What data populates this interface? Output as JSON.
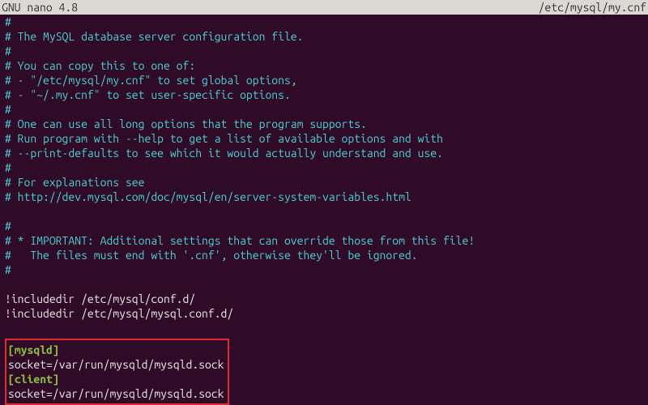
{
  "titlebar": {
    "app": "  GNU nano 4.8",
    "file": "/etc/mysql/my.cnf"
  },
  "lines": {
    "l0": "#",
    "l1": "# The MySQL database server configuration file.",
    "l2": "#",
    "l3": "# You can copy this to one of:",
    "l4": "# - \"/etc/mysql/my.cnf\" to set global options,",
    "l5": "# - \"~/.my.cnf\" to set user-specific options.",
    "l6": "#",
    "l7": "# One can use all long options that the program supports.",
    "l8": "# Run program with --help to get a list of available options and with",
    "l9": "# --print-defaults to see which it would actually understand and use.",
    "l10": "#",
    "l11": "# For explanations see",
    "l12": "# http://dev.mysql.com/doc/mysql/en/server-system-variables.html",
    "l13": "#",
    "l14": "# * IMPORTANT: Additional settings that can override those from this file!",
    "l15": "#   The files must end with '.cnf', otherwise they'll be ignored.",
    "l16": "#",
    "inc1": "!includedir /etc/mysql/conf.d/",
    "inc2": "!includedir /etc/mysql/mysql.conf.d/",
    "sec1": "[mysqld]",
    "sock1": "socket=/var/run/mysqld/mysqld.sock",
    "sec2": "[client]",
    "sock2": "socket=/var/run/mysqld/mysqld.sock"
  }
}
